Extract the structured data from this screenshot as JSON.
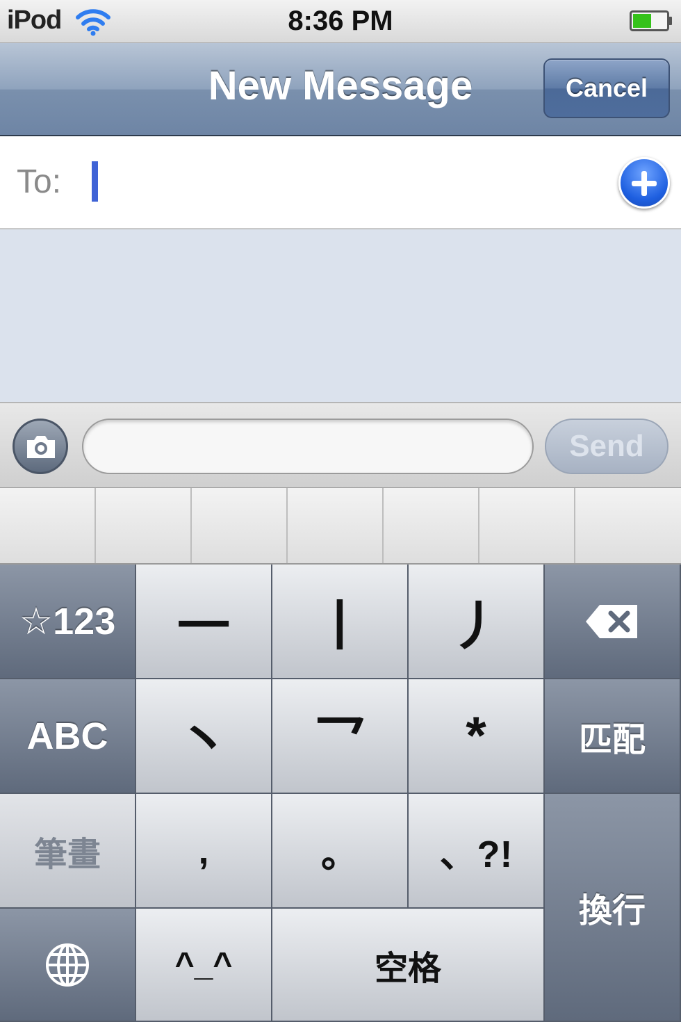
{
  "status_bar": {
    "device": "iPod",
    "time": "8:36 PM"
  },
  "nav_bar": {
    "title": "New Message",
    "cancel_label": "Cancel"
  },
  "to_field": {
    "label": "To:"
  },
  "compose": {
    "send_label": "Send",
    "message_value": ""
  },
  "keyboard": {
    "row1": {
      "symbols": "☆123",
      "stroke1": "一",
      "stroke2": "丨",
      "stroke3": "丿"
    },
    "row2": {
      "abc": "ABC",
      "stroke4": "丶",
      "stroke5": "乛",
      "wildcard": "*",
      "match": "匹配"
    },
    "row3": {
      "mode": "筆畫",
      "comma": ",",
      "period": "。",
      "punct": "、?!",
      "return": "換行"
    },
    "row4": {
      "emoticon": "^_^",
      "space": "空格"
    }
  },
  "colors": {
    "nav_bar": "#7a90ad",
    "cursor": "#3f63d6",
    "add_button": "#1e5fe0",
    "message_area": "#dbe2ed",
    "battery_fill": "#35c21a"
  },
  "icons": {
    "wifi": "wifi-icon",
    "battery": "battery-icon",
    "add_contact": "plus-circle-icon",
    "camera": "camera-icon",
    "delete": "backspace-icon",
    "globe": "globe-icon"
  }
}
